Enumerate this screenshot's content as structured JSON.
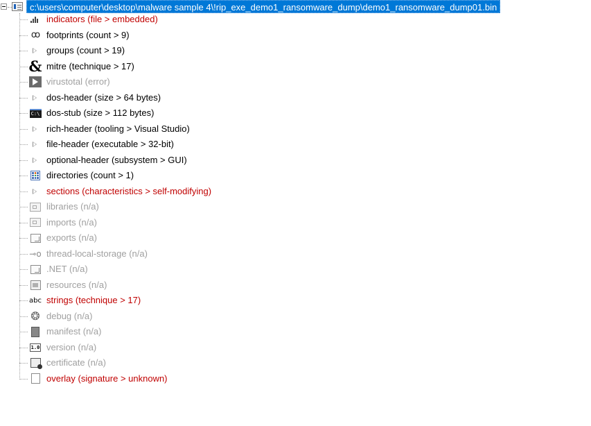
{
  "root": {
    "path": "c:\\users\\computer\\desktop\\malware sample 4\\!rip_exe_demo1_ransomware_dump\\demo1_ransomware_dump01.bin"
  },
  "nodes": [
    {
      "label": "indicators (file > embedded)",
      "icon": "bar-chart-icon",
      "state": "red"
    },
    {
      "label": "footprints (count > 9)",
      "icon": "footprints-icon",
      "state": "normal"
    },
    {
      "label": "groups (count > 19)",
      "icon": "arrow-icon",
      "state": "normal"
    },
    {
      "label": "mitre (technique > 17)",
      "icon": "ampersand-icon",
      "state": "normal"
    },
    {
      "label": "virustotal (error)",
      "icon": "virustotal-icon",
      "state": "gray"
    },
    {
      "label": "dos-header (size > 64 bytes)",
      "icon": "arrow-icon",
      "state": "normal"
    },
    {
      "label": "dos-stub (size > 112 bytes)",
      "icon": "console-icon",
      "state": "normal"
    },
    {
      "label": "rich-header (tooling > Visual Studio)",
      "icon": "arrow-icon",
      "state": "normal"
    },
    {
      "label": "file-header (executable > 32-bit)",
      "icon": "arrow-icon",
      "state": "normal"
    },
    {
      "label": "optional-header (subsystem > GUI)",
      "icon": "arrow-icon",
      "state": "normal"
    },
    {
      "label": "directories (count > 1)",
      "icon": "directories-icon",
      "state": "normal"
    },
    {
      "label": "sections (characteristics > self-modifying)",
      "icon": "arrow-icon",
      "state": "red"
    },
    {
      "label": "libraries (n/a)",
      "icon": "library-icon",
      "state": "gray"
    },
    {
      "label": "imports (n/a)",
      "icon": "import-icon",
      "state": "gray"
    },
    {
      "label": "exports (n/a)",
      "icon": "export-icon",
      "state": "gray"
    },
    {
      "label": "thread-local-storage (n/a)",
      "icon": "tls-icon",
      "state": "gray"
    },
    {
      "label": ".NET (n/a)",
      "icon": "dotnet-icon",
      "state": "gray"
    },
    {
      "label": "resources (n/a)",
      "icon": "resources-icon",
      "state": "gray"
    },
    {
      "label": "strings (technique > 17)",
      "icon": "strings-icon",
      "state": "red"
    },
    {
      "label": "debug (n/a)",
      "icon": "bug-icon",
      "state": "gray"
    },
    {
      "label": "manifest (n/a)",
      "icon": "manifest-icon",
      "state": "gray"
    },
    {
      "label": "version (n/a)",
      "icon": "version-icon",
      "state": "gray"
    },
    {
      "label": "certificate (n/a)",
      "icon": "certificate-icon",
      "state": "gray"
    },
    {
      "label": "overlay (signature > unknown)",
      "icon": "document-icon",
      "state": "red"
    }
  ],
  "icon_text": {
    "dos_stub": "C:\\",
    "version": "1.0",
    "strings": "abc",
    "tls": "⊸o",
    "footprints": "ꝏ"
  },
  "colors": {
    "selection": "#0078d7",
    "red": "#c00000",
    "gray": "#a0a0a0"
  }
}
